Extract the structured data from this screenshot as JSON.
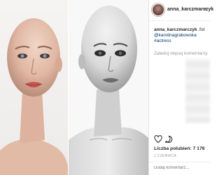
{
  "post": {
    "username": "anna_karczmarczyk",
    "header_separator": "•",
    "caption": {
      "username": "anna_karczmarczyk",
      "text": ".fot",
      "tags": [
        "@karolinagrabowska",
        "#actress"
      ]
    },
    "load_more_comments": "Załaduj więcej komentarzy",
    "likes_label": "Liczba polubień: 7 176",
    "date": "1 CZERWCA",
    "comment_placeholder": "Dodaj komentarz..."
  },
  "icons": {
    "like": "heart-icon",
    "comment": "comment-icon"
  },
  "colors": {
    "text": "#262626",
    "muted": "#999999",
    "link": "#003569",
    "border": "#efefef"
  }
}
